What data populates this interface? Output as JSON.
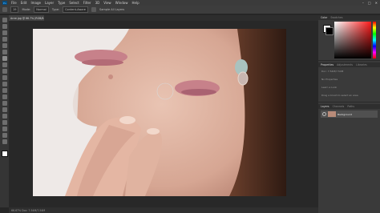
{
  "app": {
    "logo": "Ps"
  },
  "menu": [
    "File",
    "Edit",
    "Image",
    "Layer",
    "Type",
    "Select",
    "Filter",
    "3D",
    "View",
    "Window",
    "Help"
  ],
  "window_controls": [
    "–",
    "□",
    "✕"
  ],
  "options_bar": {
    "brush_size": "19",
    "mode_label": "Mode:",
    "mode_value": "Normal",
    "type_label": "Type:",
    "type_value": "Content-Aware",
    "sample_label": "Sample All Layers"
  },
  "document_tab": "Acne.jpg @ 66.7% (RGB/8#)",
  "status_bar": "66.67%   Doc: 7.54M/7.54M",
  "panels": {
    "color_tabs": [
      "Color",
      "Swatches"
    ],
    "history_tabs": [
      "Properties",
      "Adjustments",
      "Libraries"
    ],
    "history_rows": [
      "Doc: 7.54M/7.54M",
      "",
      "No Properties",
      "",
      "Learn a Look",
      "",
      "Drag a brush to select an area"
    ],
    "layers_tabs": [
      "Layers",
      "Channels",
      "Paths"
    ],
    "layer_name": "Background"
  },
  "colors": {
    "accent": "#31a8ff",
    "foreground": "#ffffff",
    "background": "#000000"
  }
}
